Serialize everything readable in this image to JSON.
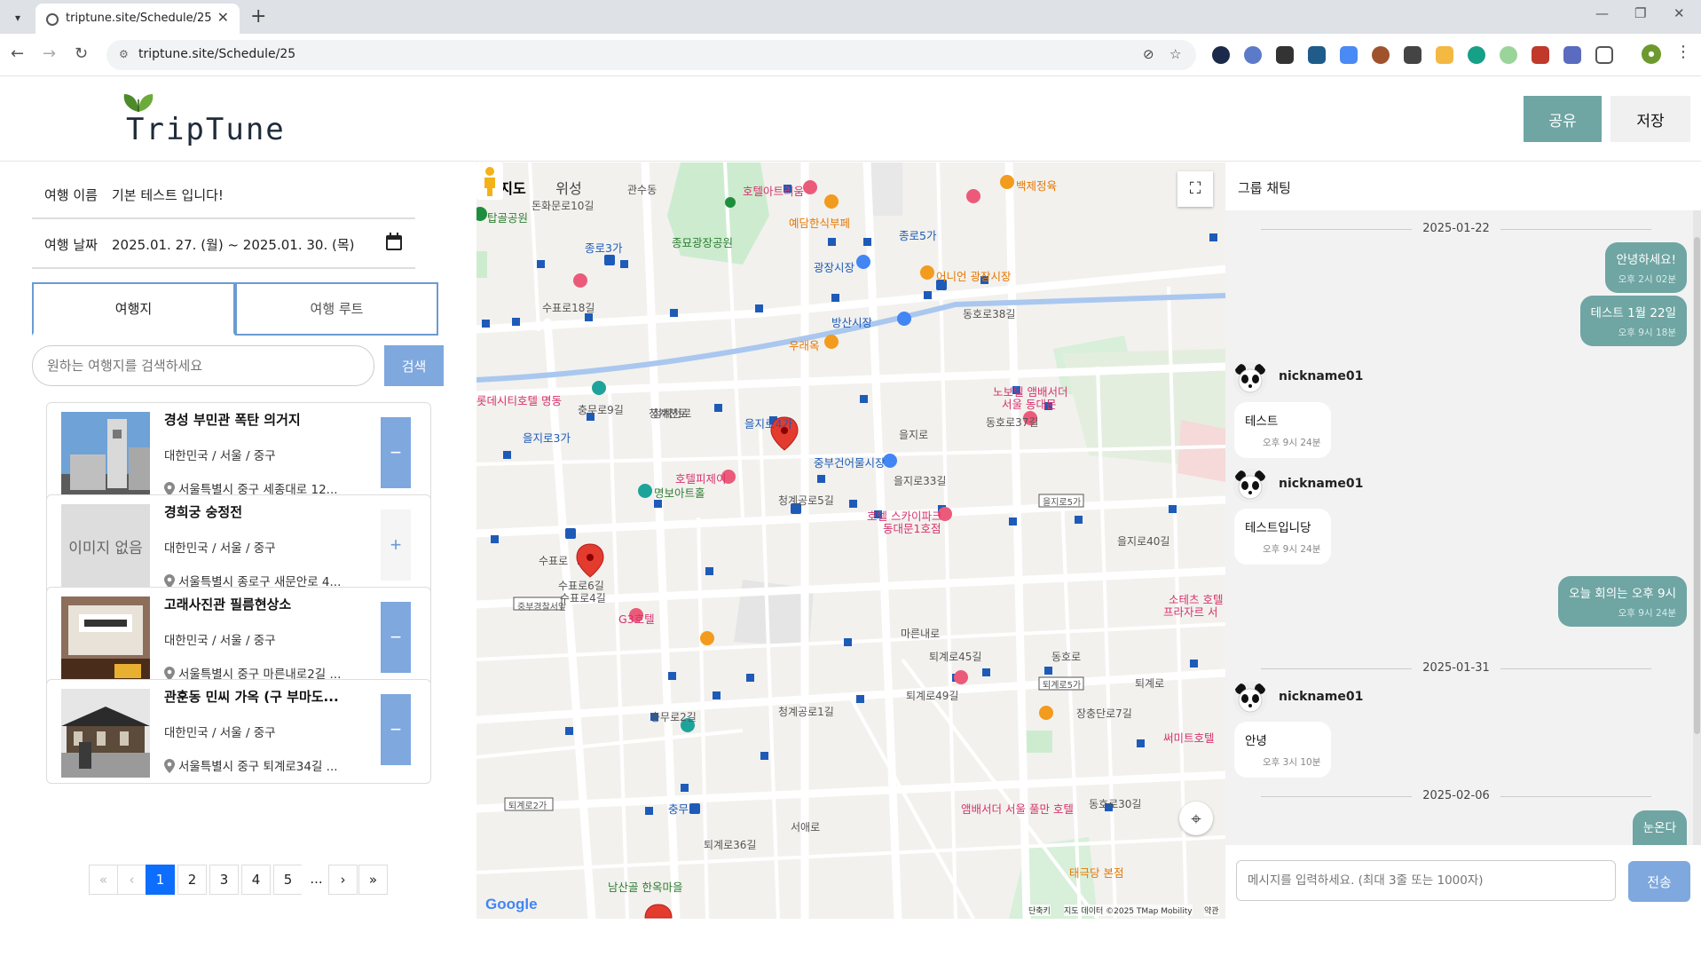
{
  "browser": {
    "tab_title": "triptune.site/Schedule/25",
    "url": "triptune.site/Schedule/25",
    "profile_label": "프로필"
  },
  "header": {
    "logo_text": "TripTune",
    "share_label": "공유",
    "save_label": "저장"
  },
  "trip": {
    "name_label": "여행 이름",
    "name_value": "기본 테스트 입니다!",
    "date_label": "여행 날짜",
    "date_value": "2025.01. 27. (월) ~ 2025.01. 30. (목)"
  },
  "tabs": {
    "places": "여행지",
    "route": "여행 루트"
  },
  "search": {
    "placeholder": "원하는 여행지를 검색하세요",
    "button": "검색"
  },
  "places": [
    {
      "name": "경성 부민관 폭탄 의거지",
      "region": "대한민국 / 서울 / 중구",
      "address": "서울특별시 중구 세종대로 12...",
      "action": "−",
      "added": true
    },
    {
      "name": "경희궁 숭정전",
      "region": "대한민국 / 서울 / 중구",
      "address": "서울특별시 종로구 새문안로 4...",
      "action": "+",
      "added": false,
      "no_image": "이미지 없음"
    },
    {
      "name": "고래사진관 필름현상소",
      "region": "대한민국 / 서울 / 중구",
      "address": "서울특별시 중구 마른내로2길 ...",
      "action": "−",
      "added": true
    },
    {
      "name": "관훈동 민씨 가옥 (구 부마도...",
      "region": "대한민국 / 서울 / 중구",
      "address": "서울특별시 중구 퇴계로34길 ...",
      "action": "−",
      "added": true
    }
  ],
  "pagination": {
    "first": "«",
    "prev": "‹",
    "pages": [
      "1",
      "2",
      "3",
      "4",
      "5"
    ],
    "ellipsis": "...",
    "next": "›",
    "last": "»",
    "current": "1"
  },
  "map": {
    "tab_map": "지도",
    "tab_satellite": "위성",
    "google": "Google",
    "attrib_shortcuts": "단축키",
    "attrib_data": "지도 데이터 ©2025 TMap Mobility",
    "attrib_terms": "약관",
    "labels": {
      "jongmyo": "종묘광장공원",
      "hotel_atrium": "호텔아트리움",
      "yedang": "예담한식부페",
      "baekje": "백제정육",
      "jongno3": "종로3가",
      "jongno5": "종로5가",
      "gwangjang": "광장시장",
      "eoneon": "어니언 광장시장",
      "tapgol": "탑골공원",
      "bangsan": "방산시장",
      "uraeok": "우래옥",
      "lotte": "롯데시티호텔 명동",
      "euljiro3": "을지로3가",
      "euljiro4": "을지로4가",
      "novotel": "노보텔 앰배서더",
      "novotel2": "서울 동대문",
      "hotel_pj": "호텔피제이",
      "myeongbo": "명보아트홀",
      "jungbu": "중부건어물시장",
      "skypark": "호텔 스카이파크",
      "skypark2": "동대문1호점",
      "g3": "G3호텔",
      "chungmuro": "충무로",
      "namsan": "남산골 한옥마을",
      "ambassador": "앰배서더 서울 풀만 호텔",
      "taegeukdang": "태극당 본점",
      "sotetel": "소테츠 호텔",
      "sotetel2": "프라자르 서",
      "ssamit": "써미트호텔",
      "jungbu_police": "중부경찰서앞",
      "dongho37": "동호로37길",
      "cheonggye": "청계천로",
      "eulji": "을지로",
      "toegye": "퇴계로",
      "marunae": "마른내로",
      "chungmu": "충무로",
      "sup": "수표로",
      "dongho": "동호로",
      "jangchung": "장충단로7길",
      "toegye2": "퇴계로2가",
      "toegye5": "퇴계로5가",
      "eulji5": "을지로5가",
      "gwansu": "관수동",
      "donhwa": "돈화문로10길",
      "chunggye_r": "청계천로",
      "dongho38": "동호로38길",
      "eulji33": "을지로33길",
      "eulji40": "을지로40길",
      "toegye45": "퇴계로45길",
      "toegye49": "퇴계로49길",
      "toegye36": "퇴계로36길",
      "dongho30": "동호로30길",
      "seoae": "서애로",
      "cheonggyesa5": "청계공로5길",
      "cheonggyesa1": "청계공로1길",
      "chungmu9": "충무로9길",
      "supyo18": "수표로18길",
      "supyo6": "수표로6길",
      "supyo4": "수표로4길",
      "chungmu2": "충무로2길",
      "gwansu_r": "관수동"
    }
  },
  "chat": {
    "title": "그룹 채팅",
    "input_placeholder": "메시지를 입력하세요. (최대 3줄 또는 1000자)",
    "send": "전송",
    "dates": [
      "2025-01-22",
      "2025-01-31",
      "2025-02-06"
    ],
    "messages": [
      {
        "mine": true,
        "text": "안녕하세요!",
        "time": "오후 2시 02분"
      },
      {
        "mine": true,
        "text": "테스트 1월 22일",
        "time": "오후 9시 18분"
      },
      {
        "mine": false,
        "nick": "nickname01",
        "text": "테스트",
        "time": "오후 9시 24분"
      },
      {
        "mine": false,
        "nick": "nickname01",
        "text": "테스트입니당",
        "time": "오후 9시 24분"
      },
      {
        "mine": true,
        "text": "오늘 회의는 오후 9시",
        "time": "오후 9시 24분"
      },
      {
        "mine": false,
        "nick": "nickname01",
        "text": "안녕",
        "time": "오후 3시 10분"
      },
      {
        "mine": true,
        "text": "눈온다",
        "time": ""
      }
    ]
  },
  "colors": {
    "accent_teal": "#6fa5a3",
    "accent_blue": "#7ea8de",
    "page_active": "#0d6efd"
  }
}
